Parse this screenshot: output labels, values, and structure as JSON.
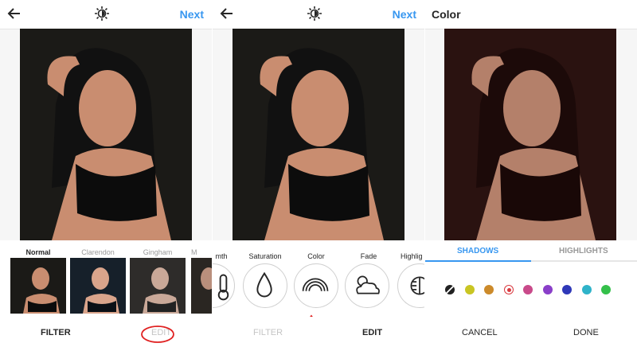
{
  "panels": [
    {
      "top": {
        "next": "Next",
        "back_icon": "arrow-left-icon",
        "lux_icon": "lux-sun-icon"
      },
      "filters": [
        {
          "name": "Normal",
          "selected": true
        },
        {
          "name": "Clarendon",
          "selected": false
        },
        {
          "name": "Gingham",
          "selected": false
        },
        {
          "name": "M",
          "selected": false
        }
      ],
      "bottom": {
        "filter": "FILTER",
        "edit": "EDIT"
      }
    },
    {
      "top": {
        "next": "Next",
        "back_icon": "arrow-left-icon",
        "lux_icon": "lux-sun-icon"
      },
      "tools": [
        {
          "name": "mth",
          "icon": "thermometer-icon"
        },
        {
          "name": "Saturation",
          "icon": "droplet-icon"
        },
        {
          "name": "Color",
          "icon": "rainbow-icon"
        },
        {
          "name": "Fade",
          "icon": "cloud-sun-icon"
        },
        {
          "name": "Highlig",
          "icon": "highlights-icon"
        }
      ],
      "bottom": {
        "filter": "FILTER",
        "edit": "EDIT"
      }
    },
    {
      "top": {
        "title": "Color"
      },
      "segments": {
        "shadows": "SHADOWS",
        "highlights": "HIGHLIGHTS"
      },
      "swatches": [
        "#333333",
        "#c9c523",
        "#cc8a2a",
        "#d9393f",
        "#c94a8a",
        "#8a3fc9",
        "#2f38b8",
        "#2fb3c9",
        "#34c04a"
      ],
      "bottom": {
        "cancel": "CANCEL",
        "done": "DONE"
      }
    }
  ],
  "colors": {
    "accent": "#3897f0",
    "annotation": "#e02020"
  }
}
